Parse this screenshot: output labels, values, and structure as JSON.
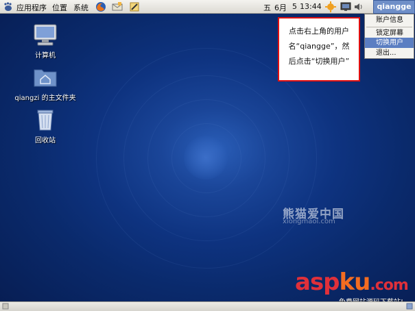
{
  "top_panel": {
    "menus": [
      "应用程序",
      "位置",
      "系统"
    ],
    "clock_day": "五",
    "clock_month": "6月",
    "clock_date": "5",
    "clock_time": "13:44",
    "user": "qiangge",
    "icons": [
      "foot-icon",
      "firefox-icon",
      "mail-icon",
      "edit-icon",
      "update-icon",
      "display-icon",
      "volume-icon"
    ]
  },
  "user_menu": {
    "items": [
      "账户信息",
      "锁定屏幕",
      "切换用户",
      "退出..."
    ],
    "active_index": 2
  },
  "callout": {
    "lines": [
      "点击右上角的用户",
      "名“qiangge”，然",
      "后点击“切换用户”"
    ]
  },
  "desktop_icons": [
    {
      "label": "计算机",
      "icon": "computer-icon"
    },
    {
      "label": "qiangzi 的主文件夹",
      "icon": "home-folder-icon"
    },
    {
      "label": "回收站",
      "icon": "trash-icon"
    }
  ],
  "watermark": {
    "cn": "熊猫爱中国",
    "en": "xiongmaoi.com",
    "site_a": "asp",
    "site_b": "ku",
    "site_c": ".com",
    "subtitle": "免费网站源码下载站!"
  },
  "colors": {
    "desktop_bg": "#0c2f75",
    "panel_bg": "#e6e4de",
    "user_button": "#6f8fc8",
    "menu_highlight": "#5b7ec2",
    "callout_border": "#e10f0f"
  }
}
